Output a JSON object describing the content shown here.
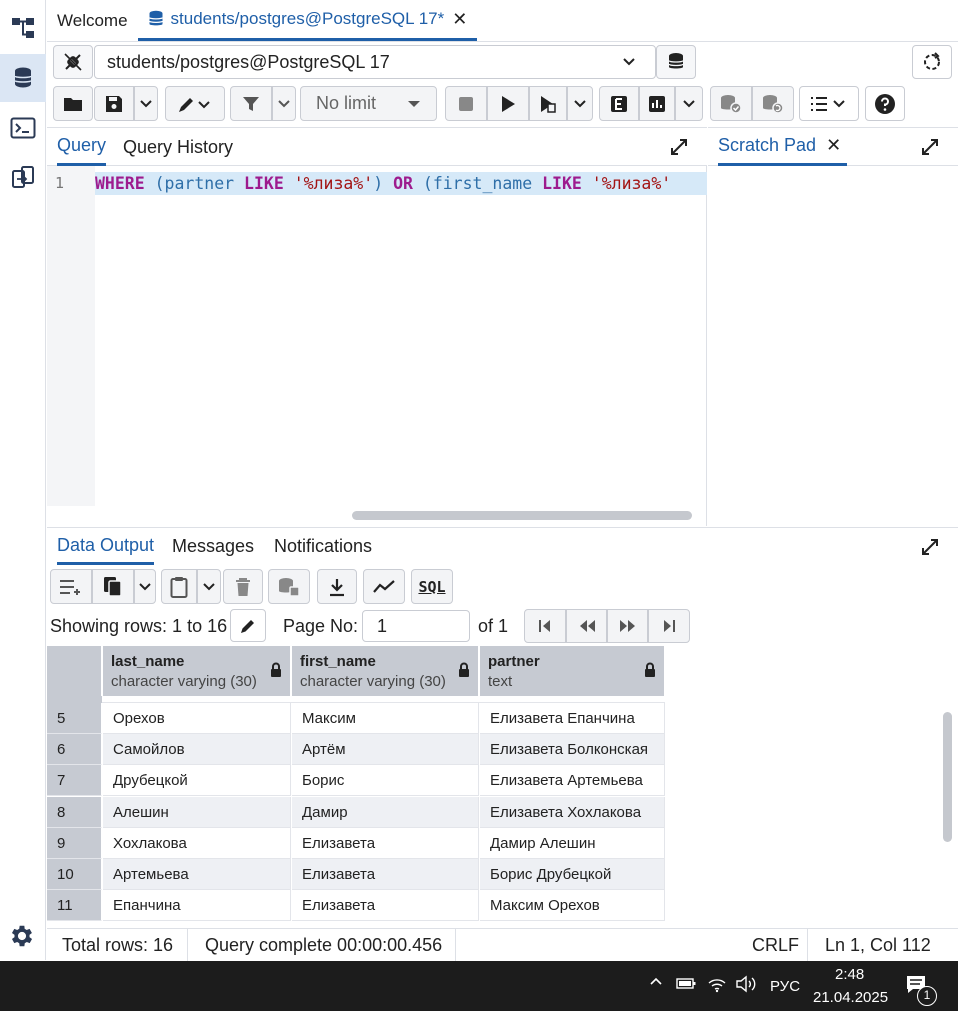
{
  "tabs": {
    "welcome": "Welcome",
    "query_tab": "students/postgres@PostgreSQL 17*"
  },
  "connection": {
    "value": "students/postgres@PostgreSQL 17"
  },
  "toolbar": {
    "limit": "No limit"
  },
  "query_panel": {
    "tab_query": "Query",
    "tab_history": "Query History",
    "line_number": "1",
    "code": {
      "kw_where": "WHERE",
      "paren_open_1": " (",
      "col_partner": "partner",
      "kw_like_1": " LIKE ",
      "str_1": "'%лиза%'",
      "paren_close_1": ") ",
      "kw_or": "OR",
      "paren_open_2": " (",
      "col_first_name": "first_name",
      "kw_like_2": " LIKE ",
      "str_2": "'%лиза%'"
    }
  },
  "scratch_pad": {
    "title": "Scratch Pad"
  },
  "results": {
    "tab_data": "Data Output",
    "tab_messages": "Messages",
    "tab_notifications": "Notifications",
    "showing": "Showing rows: 1 to 16",
    "page_label": "Page No:",
    "page_value": "1",
    "page_of": "of 1",
    "sql_label": "SQL",
    "columns": [
      {
        "name": "last_name",
        "type": "character varying (30)"
      },
      {
        "name": "first_name",
        "type": "character varying (30)"
      },
      {
        "name": "partner",
        "type": "text"
      }
    ],
    "rows": [
      {
        "n": "5",
        "c": [
          "Орехов",
          "Максим",
          "Елизавета Епанчина"
        ]
      },
      {
        "n": "6",
        "c": [
          "Самойлов",
          "Артём",
          "Елизавета Болконская"
        ]
      },
      {
        "n": "7",
        "c": [
          "Друбецкой",
          "Борис",
          "Елизавета Артемьева"
        ]
      },
      {
        "n": "8",
        "c": [
          "Алешин",
          "Дамир",
          "Елизавета Хохлакова"
        ]
      },
      {
        "n": "9",
        "c": [
          "Хохлакова",
          "Елизавета",
          "Дамир Алешин"
        ]
      },
      {
        "n": "10",
        "c": [
          "Артемьева",
          "Елизавета",
          "Борис Друбецкой"
        ]
      },
      {
        "n": "11",
        "c": [
          "Епанчина",
          "Елизавета",
          "Максим Орехов"
        ]
      }
    ]
  },
  "status": {
    "total": "Total rows: 16",
    "query": "Query complete 00:00:00.456",
    "eol": "CRLF",
    "position": "Ln 1, Col 112"
  },
  "taskbar": {
    "lang": "РУС",
    "time": "2:48",
    "date": "21.04.2025",
    "notif_count": "1"
  }
}
